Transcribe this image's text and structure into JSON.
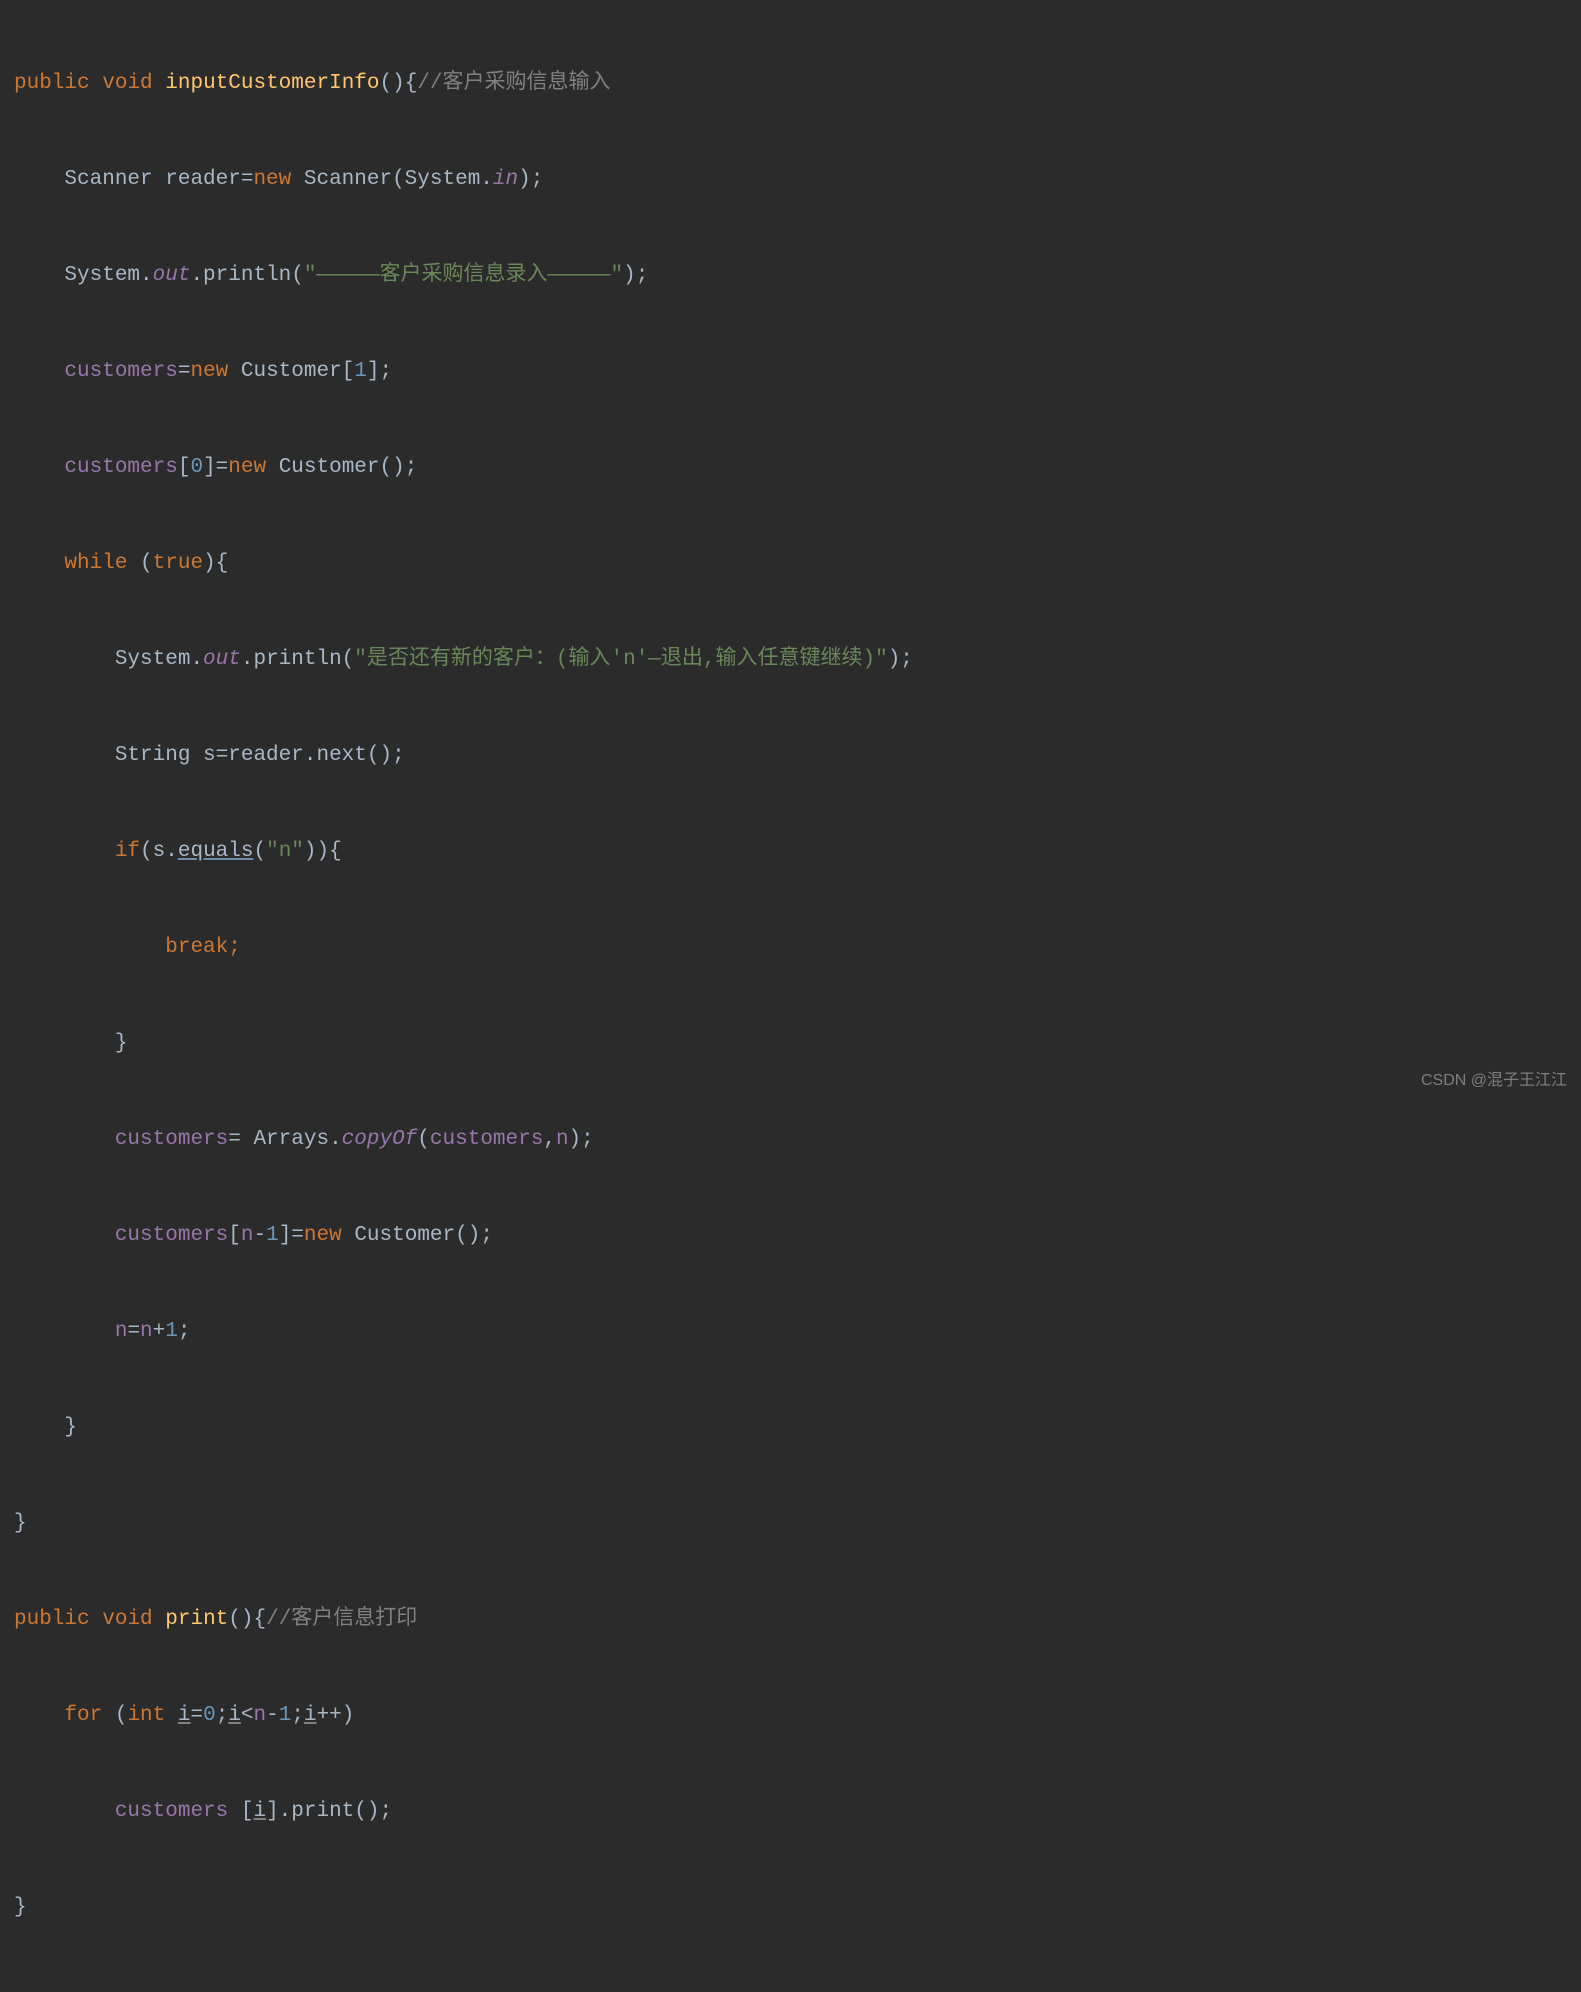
{
  "code": {
    "line1": {
      "public": "public",
      "void": "void",
      "method": "inputCustomerInfo",
      "parens": "(){",
      "comment": "//客户采购信息输入"
    },
    "line2": {
      "indent": "    ",
      "text1": "Scanner reader=",
      "new": "new",
      "text2": " Scanner(System.",
      "in": "in",
      "text3": ");"
    },
    "line3": {
      "indent": "    ",
      "text1": "System.",
      "out": "out",
      "text2": ".println(",
      "string": "\"—————客户采购信息录入—————\"",
      "text3": ");"
    },
    "line4": {
      "indent": "    ",
      "customers": "customers",
      "text1": "=",
      "new": "new",
      "text2": " Customer[",
      "num": "1",
      "text3": "];"
    },
    "line5": {
      "indent": "    ",
      "customers": "customers",
      "text1": "[",
      "num": "0",
      "text2": "]=",
      "new": "new",
      "text3": " Customer();"
    },
    "line6": {
      "indent": "    ",
      "while": "while",
      "text1": " (",
      "true": "true",
      "text2": "){"
    },
    "line7": {
      "indent": "        ",
      "text1": "System.",
      "out": "out",
      "text2": ".println(",
      "string": "\"是否还有新的客户：(输入'n'—退出,输入任意键继续)\"",
      "text3": ");"
    },
    "line8": {
      "indent": "        ",
      "text1": "String s=reader.next();"
    },
    "line9": {
      "indent": "        ",
      "if": "if",
      "text1": "(s.",
      "equals": "equals",
      "text2": "(",
      "string": "\"n\"",
      "text3": ")){"
    },
    "line10": {
      "indent": "            ",
      "break": "break",
      "semi": ";"
    },
    "line11": {
      "indent": "        ",
      "brace": "}"
    },
    "line12": {
      "indent": "        ",
      "customers": "customers",
      "text1": "= Arrays.",
      "copyOf": "copyOf",
      "text2": "(",
      "customers2": "customers",
      "text3": ",",
      "n": "n",
      "text4": ");"
    },
    "line13": {
      "indent": "        ",
      "customers": "customers",
      "text1": "[",
      "n": "n",
      "text2": "-",
      "num": "1",
      "text3": "]=",
      "new": "new",
      "text4": " Customer();"
    },
    "line14": {
      "indent": "        ",
      "n": "n",
      "text1": "=",
      "n2": "n",
      "text2": "+",
      "num": "1",
      "text3": ";"
    },
    "line15": {
      "indent": "    ",
      "brace": "}"
    },
    "line16": {
      "brace": "}"
    },
    "line17": {
      "public": "public",
      "void": "void",
      "method": "print",
      "parens": "(){",
      "comment": "//客户信息打印"
    },
    "line18": {
      "indent": "    ",
      "for": "for",
      "text1": " (",
      "int": "int",
      "text2": " ",
      "i1": "i",
      "text3": "=",
      "num0": "0",
      "text4": ";",
      "i2": "i",
      "text5": "<",
      "n": "n",
      "text6": "-",
      "num1": "1",
      "text7": ";",
      "i3": "i",
      "text8": "++)"
    },
    "line19": {
      "indent": "        ",
      "customers": "customers",
      "text1": " [",
      "i": "i",
      "text2": "].print();"
    },
    "line20": {
      "brace": "}"
    }
  },
  "watermark": "CSDN @混子王江江"
}
